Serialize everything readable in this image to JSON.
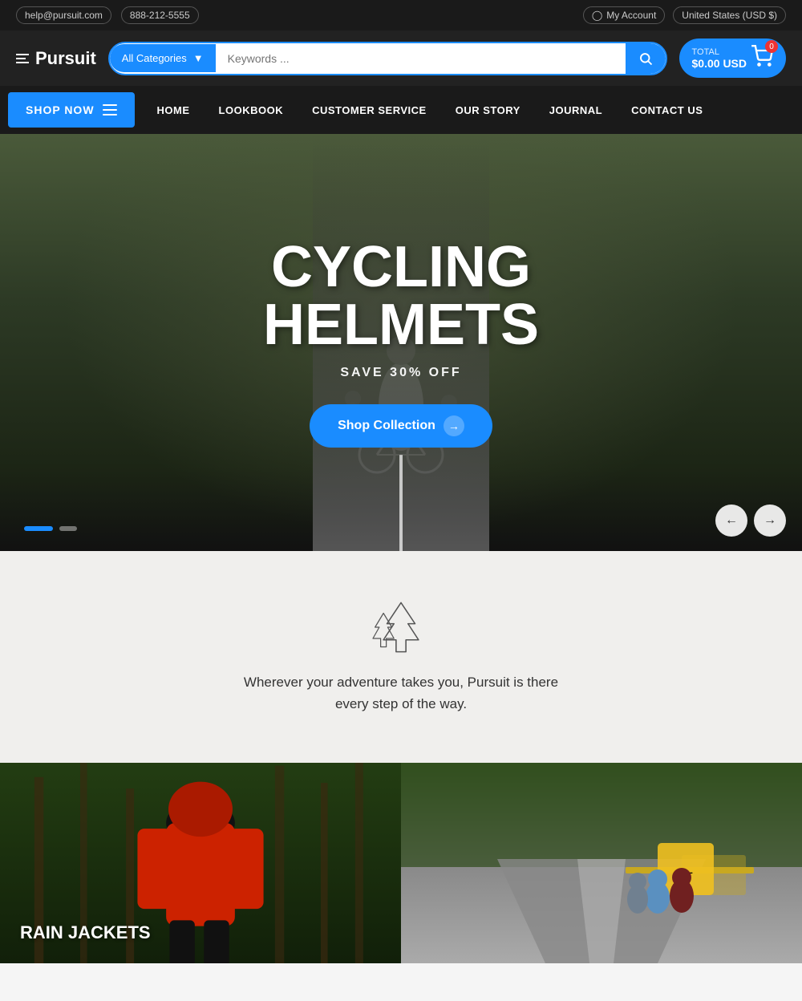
{
  "topBar": {
    "email": "help@pursuit.com",
    "phone": "888-212-5555",
    "account": "My Account",
    "region": "United States (USD $)"
  },
  "header": {
    "logo": "Pursuit",
    "categoryPlaceholder": "All Categories",
    "searchPlaceholder": "Keywords ...",
    "cartLabel": "TOTAL",
    "cartTotal": "$0.00 USD",
    "cartCount": "0"
  },
  "nav": {
    "shopNow": "SHOP NOW",
    "links": [
      "HOME",
      "LOOKBOOK",
      "CUSTOMER SERVICE",
      "OUR STORY",
      "JOURNAL",
      "CONTACT US"
    ]
  },
  "hero": {
    "title": "CYCLING\nHELMETS",
    "subtitle": "SAVE 30% OFF",
    "cta": "Shop Collection"
  },
  "adventure": {
    "text": "Wherever your adventure takes you, Pursuit is there every step of the way."
  },
  "categories": [
    {
      "label": "RAIN JACKETS"
    },
    {
      "label": ""
    }
  ],
  "slider": {
    "prevLabel": "←",
    "nextLabel": "→"
  }
}
